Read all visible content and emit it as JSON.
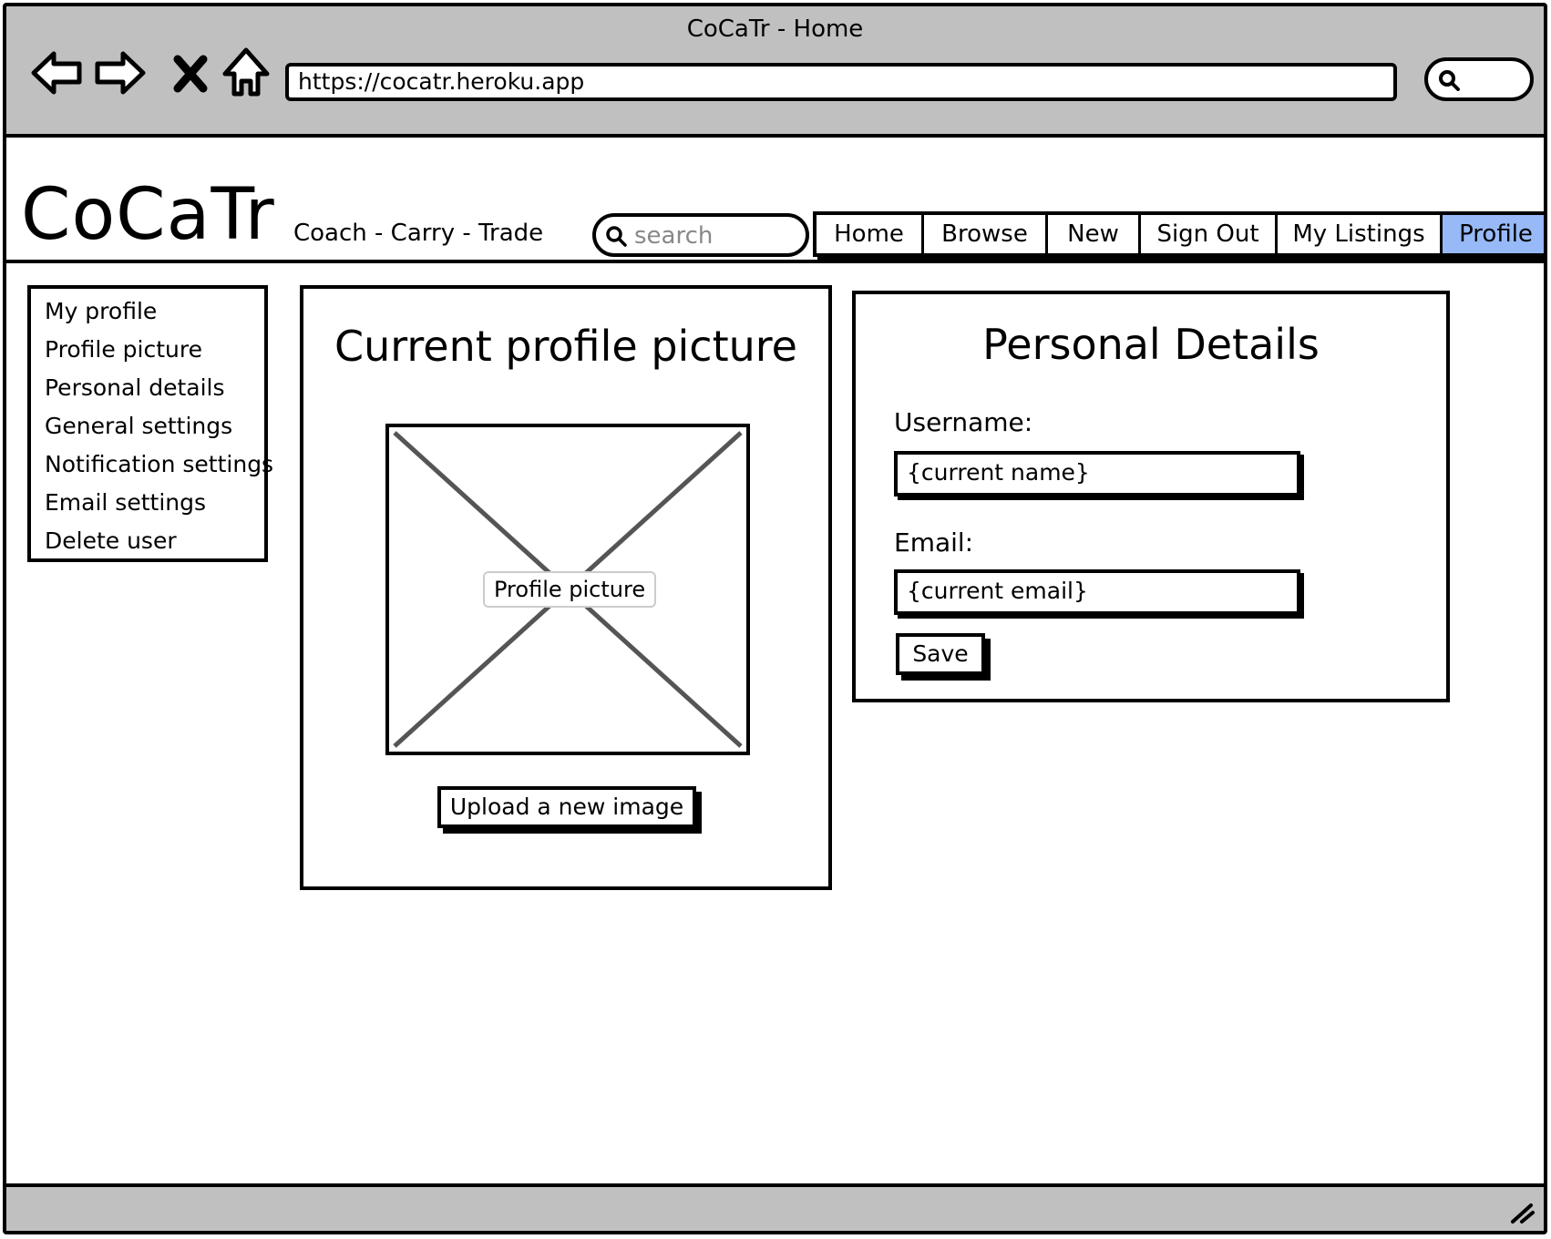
{
  "window": {
    "title": "CoCaTr - Home"
  },
  "browser": {
    "url": "https://cocatr.heroku.app",
    "icons": [
      "back-arrow-icon",
      "forward-arrow-icon",
      "close-icon",
      "home-icon",
      "search-icon"
    ]
  },
  "header": {
    "logo": "CoCaTr",
    "tagline": "Coach - Carry - Trade",
    "search_placeholder": "search",
    "nav": [
      {
        "label": "Home",
        "active": false
      },
      {
        "label": "Browse",
        "active": false
      },
      {
        "label": "New",
        "active": false
      },
      {
        "label": "Sign Out",
        "active": false
      },
      {
        "label": "My Listings",
        "active": false
      },
      {
        "label": "Profile",
        "active": true
      }
    ],
    "active_color": "#97b9f7"
  },
  "side_menu": {
    "items": [
      "My profile",
      "Profile picture",
      "Personal details",
      "General settings",
      "Notification settings",
      "Email settings",
      "Delete user"
    ]
  },
  "picture_panel": {
    "heading": "Current profile picture",
    "placeholder_label": "Profile picture",
    "upload_label": "Upload a new image"
  },
  "details_panel": {
    "heading": "Personal Details",
    "username_label": "Username:",
    "username_value": "{current name}",
    "email_label": "Email:",
    "email_value": "{current email}",
    "save_label": "Save"
  }
}
